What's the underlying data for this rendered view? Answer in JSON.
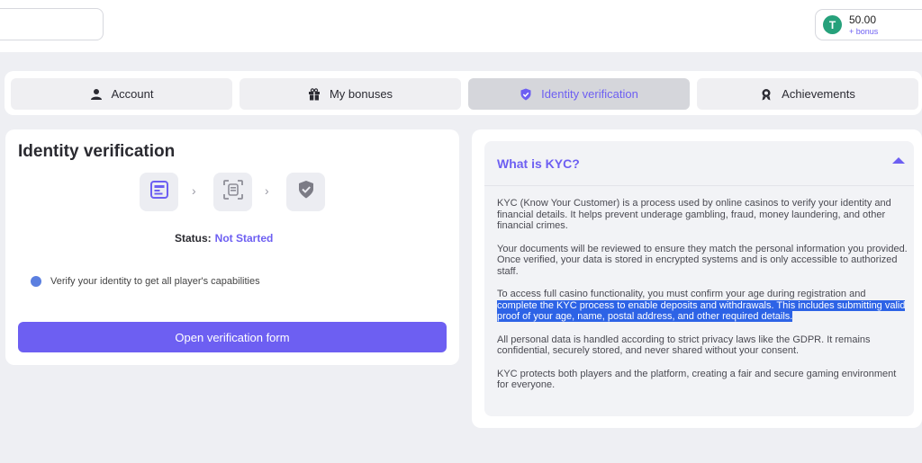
{
  "balance": {
    "amount": "50.00",
    "bonus_label": "+ bonus",
    "coin_symbol": "T"
  },
  "tabs": [
    {
      "label": "Account",
      "icon": "user-icon"
    },
    {
      "label": "My bonuses",
      "icon": "gift-icon"
    },
    {
      "label": "Identity verification",
      "icon": "shield-check-icon"
    },
    {
      "label": "Achievements",
      "icon": "medal-icon"
    }
  ],
  "active_tab": "Identity verification",
  "identity": {
    "title": "Identity verification",
    "steps": [
      {
        "icon": "id-card-icon"
      },
      {
        "icon": "face-scan-icon"
      },
      {
        "icon": "shield-check-icon"
      }
    ],
    "status_label": "Status:",
    "status_value": "Not Started",
    "hint": "Verify your identity to get all player's capabilities",
    "button_label": "Open verification form"
  },
  "kyc": {
    "title": "What is KYC?",
    "p1": "KYC (Know Your Customer) is a process used by online casinos to verify your identity and financial details. It helps prevent underage gambling, fraud, money laundering, and other financial crimes.",
    "p2": "Your documents will be reviewed to ensure they match the personal information you provided. Once verified, your data is stored in encrypted systems and is only accessible to authorized staff.",
    "p3_a": "To access full casino functionality, you must confirm your age during registration and ",
    "p3_b": "complete the KYC process to enable deposits and withdrawals. This includes submitting valid proof of your age, name, postal address, and other required details.",
    "p4": "All personal data is handled according to strict privacy laws like the GDPR. It remains confidential, securely stored, and never shared without your consent.",
    "p5": "KYC protects both players and the platform, creating a fair and secure gaming environment for everyone."
  },
  "colors": {
    "accent": "#6d5ff2",
    "highlight": "#2d63e6",
    "coin": "#26a17b"
  }
}
